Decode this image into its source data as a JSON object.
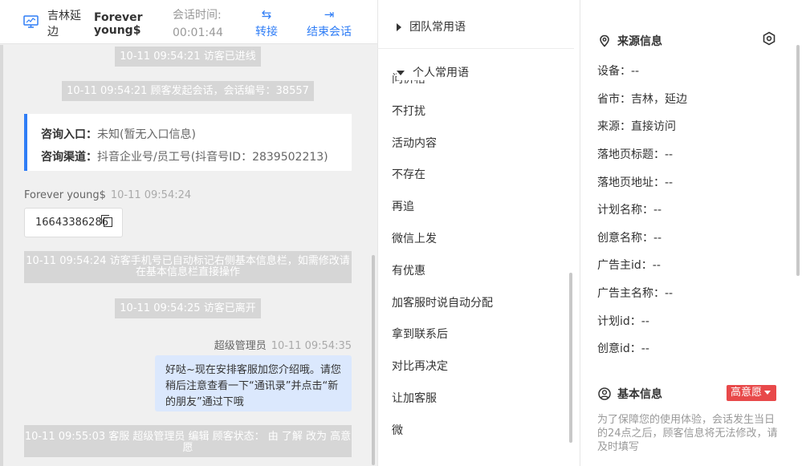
{
  "header": {
    "location": "吉林延边",
    "visitor_name": "Forever young$",
    "time_label": "会话时间:",
    "time_value": "00:01:44",
    "transfer_label": "转接",
    "end_label": "结束会话",
    "accent_color": "#2f7df6"
  },
  "chat": {
    "sys_entered": "10-11 09:54:21 访客已进线",
    "sys_started": "10-11 09:54:21 顾客发起会话，会话编号：38557",
    "consult_entry_label": "咨询入口：",
    "consult_entry_value": "未知(暂无入口信息)",
    "consult_channel_label": "咨询渠道：",
    "consult_channel_value": "抖音企业号/员工号(抖音号ID：2839502213)",
    "visitor_sender": "Forever young$",
    "visitor_time": "10-11 09:54:24",
    "phone": "16643386286",
    "sys_phone_note": "10-11 09:54:24 访客手机号已自动标记右侧基本信息栏，如需修改请在基本信息栏直接操作",
    "sys_left": "10-11 09:54:25 访客已离开",
    "agent_sender": "超级管理员",
    "agent_time": "10-11 09:54:35",
    "agent_message": "好哒~现在安排客服加您介绍哦。请您稍后注意查看一下“通讯录”并点击“新的朋友”通过下哦",
    "sys_status": "10-11 09:55:03 客服 超级管理员 编辑 顾客状态： 由 了解 改为 高意愿"
  },
  "phrases": {
    "team_group": "团队常用语",
    "personal_group": "个人常用语",
    "cut_item": "问价格",
    "items": [
      "不打扰",
      "活动内容",
      "不存在",
      "再追",
      "微信上发",
      "有优惠",
      "加客服时说自动分配",
      "拿到联系后",
      "对比再决定",
      "让加客服",
      "微"
    ]
  },
  "info": {
    "source_title": "来源信息",
    "rows": [
      {
        "label": "设备：",
        "value": "--"
      },
      {
        "label": "省市：",
        "value": "吉林，延边"
      },
      {
        "label": "来源：",
        "value": "直接访问"
      },
      {
        "label": "落地页标题：",
        "value": "--"
      },
      {
        "label": "落地页地址：",
        "value": "--"
      },
      {
        "label": "计划名称：",
        "value": "--"
      },
      {
        "label": "创意名称：",
        "value": "--"
      },
      {
        "label": "广告主id：",
        "value": "--"
      },
      {
        "label": "广告主名称：",
        "value": "--"
      },
      {
        "label": "计划id：",
        "value": "--"
      },
      {
        "label": "创意id：",
        "value": "--"
      }
    ],
    "basic_title": "基本信息",
    "intent_tag": "高意愿",
    "intent_color": "#e8494a",
    "notice": "为了保障您的使用体验，会话发生当日的24点之后，顾客信息将无法修改，请及时填写"
  }
}
